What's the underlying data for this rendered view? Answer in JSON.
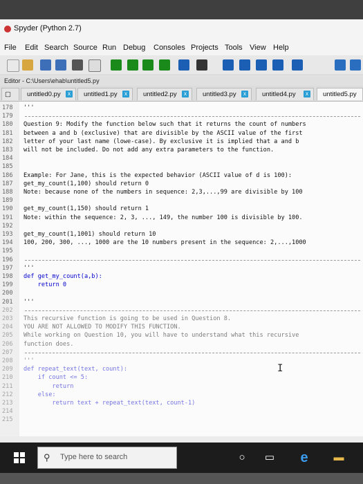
{
  "window": {
    "title": "Spyder (Python 2.7)"
  },
  "menu": [
    "File",
    "Edit",
    "Search",
    "Source",
    "Run",
    "Debug",
    "Consoles",
    "Projects",
    "Tools",
    "View",
    "Help"
  ],
  "editor_path": "Editor - C:\\Users\\ehab\\untitled5.py",
  "tabs": [
    {
      "label": "untitled0.py",
      "close": "x"
    },
    {
      "label": "untitled1.py",
      "close": "x"
    },
    {
      "label": "untitled2.py",
      "close": "x"
    },
    {
      "label": "untitled3.py",
      "close": "x"
    },
    {
      "label": "untitled4.py",
      "close": "x"
    },
    {
      "label": "untitled5.py"
    }
  ],
  "code_lines": [
    {
      "n": "178",
      "t": "'''"
    },
    {
      "n": "179",
      "t": ""
    },
    {
      "n": "180",
      "t": "Question 9: Modify the function below such that it returns the count of numbers"
    },
    {
      "n": "181",
      "t": "between a and b (exclusive) that are divisible by the ASCII value of the first"
    },
    {
      "n": "182",
      "t": "letter of your last name (lowe-case). By exclusive it is implied that a and b"
    },
    {
      "n": "183",
      "t": "will not be included. Do not add any extra parameters to the function."
    },
    {
      "n": "184",
      "t": ""
    },
    {
      "n": "185",
      "t": ""
    },
    {
      "n": "186",
      "t": "Example: For Jane, this is the expected behavior (ASCII value of d is 100):"
    },
    {
      "n": "187",
      "t": "get_my_count(1,100) should return 0"
    },
    {
      "n": "188",
      "t": "Note: because none of the numbers in sequence: 2,3,...,99 are divisible by 100"
    },
    {
      "n": "189",
      "t": ""
    },
    {
      "n": "190",
      "t": "get_my_count(1,150) should return 1"
    },
    {
      "n": "191",
      "t": "Note: within the sequence: 2, 3, ..., 149, the number 100 is divisible by 100."
    },
    {
      "n": "192",
      "t": ""
    },
    {
      "n": "193",
      "t": "get_my_count(1,1001) should return 10"
    },
    {
      "n": "194",
      "t": "100, 200, 300, ..., 1000 are the 10 numbers present in the sequence: 2,...,1000"
    },
    {
      "n": "195",
      "t": ""
    },
    {
      "n": "196",
      "t": ""
    },
    {
      "n": "197",
      "t": "'''"
    },
    {
      "n": "198",
      "t": "def get_my_count(a,b):"
    },
    {
      "n": "199",
      "t": "    return 0"
    },
    {
      "n": "200",
      "t": ""
    },
    {
      "n": "201",
      "t": "'''"
    },
    {
      "n": "202",
      "t": ""
    },
    {
      "n": "203",
      "t": "This recursive function is going to be used in Question 8."
    },
    {
      "n": "204",
      "t": "YOU ARE NOT ALLOWED TO MODIFY THIS FUNCTION."
    },
    {
      "n": "205",
      "t": "While working on Question 10, you will have to understand what this recursive"
    },
    {
      "n": "206",
      "t": "function does."
    },
    {
      "n": "207",
      "t": ""
    },
    {
      "n": "208",
      "t": "'''"
    },
    {
      "n": "209",
      "t": "def repeat_text(text, count):"
    },
    {
      "n": "210",
      "t": "    if count <= 5:"
    },
    {
      "n": "211",
      "t": "        return"
    },
    {
      "n": "212",
      "t": "    else:"
    },
    {
      "n": "213",
      "t": "        return text + repeat_text(text, count-1)"
    },
    {
      "n": "214",
      "t": ""
    },
    {
      "n": "215",
      "t": ""
    }
  ],
  "taskbar": {
    "search_placeholder": "Type here to search"
  },
  "icons": {
    "window": "spyder-icon",
    "start": "windows-logo-icon",
    "search": "search-icon",
    "cortana": "circle-icon",
    "taskview": "task-view-icon",
    "edge": "edge-browser-icon"
  }
}
